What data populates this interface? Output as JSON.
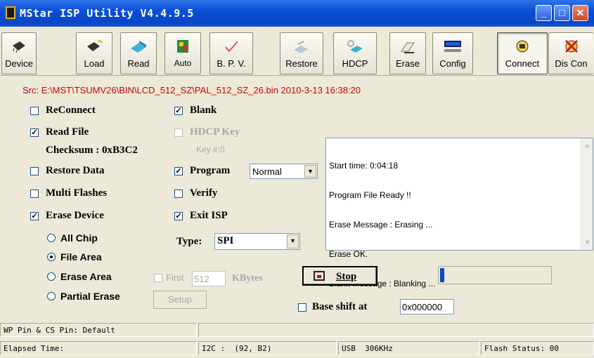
{
  "window": {
    "title": "MStar ISP Utility V4.4.9.5"
  },
  "toolbar": {
    "buttons": [
      {
        "label": "Device",
        "icon": "chip-icon"
      },
      {
        "label": "Load",
        "icon": "chip-load-icon"
      },
      {
        "label": "Read",
        "icon": "read-icon"
      },
      {
        "label": "Auto",
        "icon": "auto-icon"
      },
      {
        "label": "B. P. V.",
        "icon": "bpv-icon"
      },
      {
        "label": "Restore",
        "icon": "restore-icon"
      },
      {
        "label": "HDCP",
        "icon": "hdcp-icon"
      },
      {
        "label": "Erase",
        "icon": "erase-icon"
      },
      {
        "label": "Config",
        "icon": "config-icon"
      },
      {
        "label": "Connect",
        "icon": "connect-icon"
      },
      {
        "label": "Dis Con",
        "icon": "disconnect-icon"
      }
    ]
  },
  "source_file": "Src: E:\\MST\\TSUMV26\\BIN\\LCD_512_SZ\\PAL_512_SZ_26.bin 2010-3-13 16:38:20",
  "options": {
    "reconnect": {
      "label": "ReConnect",
      "checked": false
    },
    "read_file": {
      "label": "Read File",
      "checked": true
    },
    "checksum": "Checksum : 0xB3C2",
    "restore_data": {
      "label": "Restore Data",
      "checked": false
    },
    "multi_flashes": {
      "label": "Multi Flashes",
      "checked": false
    },
    "erase_device": {
      "label": "Erase Device",
      "checked": true
    },
    "blank": {
      "label": "Blank",
      "checked": true
    },
    "hdcp_key": {
      "label": "HDCP Key",
      "checked": false
    },
    "key_num": "Key #:0",
    "program": {
      "label": "Program",
      "checked": true,
      "mode": "Normal"
    },
    "verify": {
      "label": "Verify",
      "checked": false
    },
    "exit_isp": {
      "label": "Exit ISP",
      "checked": true
    }
  },
  "erase_mode": {
    "options": [
      "All Chip",
      "File Area",
      "Erase Area",
      "Partial Erase"
    ],
    "selected": "File Area"
  },
  "type": {
    "label": "Type:",
    "value": "SPI"
  },
  "first": {
    "label": "First",
    "value": "512",
    "unit": "KBytes"
  },
  "setup_label": "Setup",
  "stop_label": "Stop",
  "progress": 0.04,
  "base_shift": {
    "label": "Base shift at",
    "value": "0x000000"
  },
  "log": [
    "Start time: 0:04:18",
    "Program File Ready !!",
    "Erase Message : Erasing ...",
    "Erase OK.",
    "Blank Message : Blanking ..."
  ],
  "status": {
    "pin": "WP Pin & CS Pin: Default",
    "elapsed": "Elapsed Time:",
    "i2c": "I2C :  (92, B2)",
    "usb": "USB  306KHz",
    "flash": "Flash Status: 00"
  }
}
